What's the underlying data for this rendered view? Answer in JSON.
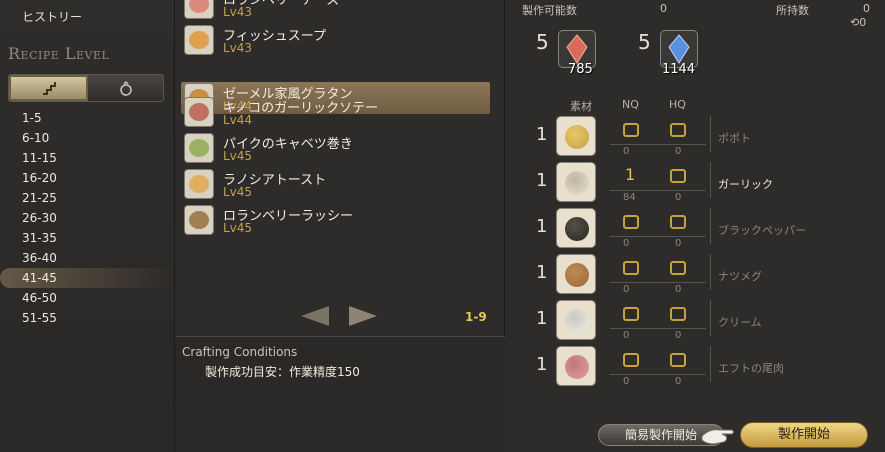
{
  "left": {
    "history_label": "ヒストリー",
    "recipe_level_title": "Recipe Level",
    "toggle": [
      {
        "icon": "stairs-icon"
      },
      {
        "icon": "moneybag-icon"
      }
    ],
    "levels": [
      "1-5",
      "6-10",
      "11-15",
      "16-20",
      "21-25",
      "26-30",
      "31-35",
      "36-40",
      "41-45",
      "46-50",
      "51-55"
    ],
    "selected_level": "41-45"
  },
  "recipes": {
    "items": [
      {
        "name": "ロランベリーチーズ",
        "level": "Lv43",
        "icon": "cheese-dish-icon"
      },
      {
        "name": "フィッシュスープ",
        "level": "Lv43",
        "icon": "soup-dish-icon"
      },
      {
        "name": "ゼーメル家風グラタン",
        "level": "Lv44",
        "icon": "gratin-dish-icon"
      },
      {
        "name": "キノコのガーリックソテー",
        "level": "Lv44",
        "icon": "saute-dish-icon"
      },
      {
        "name": "パイクのキャベツ巻き",
        "level": "Lv45",
        "icon": "cabbage-roll-icon"
      },
      {
        "name": "ラノシアトースト",
        "level": "Lv45",
        "icon": "toast-dish-icon"
      },
      {
        "name": "ロランベリーラッシー",
        "level": "Lv45",
        "icon": "lassi-jug-icon"
      }
    ],
    "selected_index": 2,
    "page_indicator": "1-9",
    "conditions_title": "Crafting Conditions",
    "conditions_text": "製作成功目安：作業精度150"
  },
  "materials_panel": {
    "craftable_label": "製作可能数",
    "craftable_value": "0",
    "owned_label": "所持数",
    "owned_value": "0",
    "hq_owned_value": "0",
    "crystals": [
      {
        "required": "5",
        "owned": "785",
        "icon": "fire-shard-icon",
        "color": "#d86a5a"
      },
      {
        "required": "5",
        "owned": "1144",
        "icon": "water-shard-icon",
        "color": "#5a8ee0"
      }
    ],
    "col_material": "素材",
    "col_nq": "NQ",
    "col_hq": "HQ",
    "items": [
      {
        "qty": "1",
        "name": "ポポト",
        "nq_selected": "",
        "nq_owned": "0",
        "hq_owned": "0",
        "have": false,
        "icon": "popoto-icon"
      },
      {
        "qty": "1",
        "name": "ガーリック",
        "nq_selected": "1",
        "nq_owned": "84",
        "hq_owned": "0",
        "have": true,
        "icon": "garlic-icon"
      },
      {
        "qty": "1",
        "name": "ブラックペッパー",
        "nq_selected": "",
        "nq_owned": "0",
        "hq_owned": "0",
        "have": false,
        "icon": "black-pepper-icon"
      },
      {
        "qty": "1",
        "name": "ナツメグ",
        "nq_selected": "",
        "nq_owned": "0",
        "hq_owned": "0",
        "have": false,
        "icon": "nutmeg-icon"
      },
      {
        "qty": "1",
        "name": "クリーム",
        "nq_selected": "",
        "nq_owned": "0",
        "hq_owned": "0",
        "have": false,
        "icon": "cream-icon"
      },
      {
        "qty": "1",
        "name": "エフトの尾肉",
        "nq_selected": "",
        "nq_owned": "0",
        "hq_owned": "0",
        "have": false,
        "icon": "eft-tail-icon"
      }
    ],
    "quick_synth_label": "簡易製作開始",
    "start_label": "製作開始"
  }
}
